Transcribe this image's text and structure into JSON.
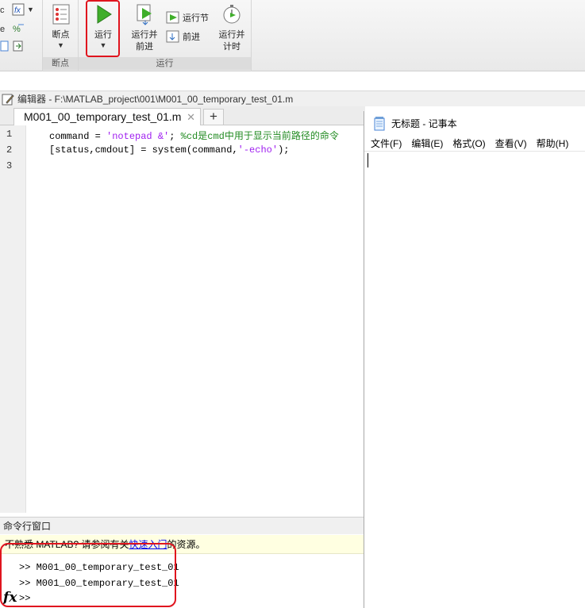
{
  "toolstrip": {
    "breakpoints_label": "断点",
    "breakpoints_section": "断点",
    "run_label": "运行",
    "run_advance_line1": "运行并",
    "run_advance_line2": "前进",
    "run_section_label": "运行节",
    "advance_label": "前进",
    "run_time_line1": "运行并",
    "run_time_line2": "计时",
    "run_section": "运行"
  },
  "editor": {
    "title": "编辑器 - F:\\MATLAB_project\\001\\M001_00_temporary_test_01.m",
    "tab_label": "M001_00_temporary_test_01.m",
    "tab_close": "✕",
    "add_tab": "+",
    "line_numbers": [
      "1",
      "2",
      "3"
    ],
    "line1_var": "command = ",
    "line1_str": "'notepad &'",
    "line1_semi": "; ",
    "line1_comment": "%cd是cmd中用于显示当前路径的命令",
    "line2_pre": "[status,cmdout] = system(command,",
    "line2_str": "'-echo'",
    "line2_post": ");"
  },
  "command_window": {
    "title": "命令行窗口",
    "banner_pre": "不熟悉 MATLAB? 请参阅有关",
    "banner_link": "快速入门",
    "banner_post": "的资源。",
    "lines": [
      ">> M001_00_temporary_test_01",
      ">> M001_00_temporary_test_01",
      ">>"
    ],
    "fx": "fx"
  },
  "notepad": {
    "title": "无标题 - 记事本",
    "menu": [
      "文件(F)",
      "编辑(E)",
      "格式(O)",
      "查看(V)",
      "帮助(H)"
    ]
  },
  "colors": {
    "highlight_red": "#e0141e",
    "string_purple": "#a020f0",
    "comment_green": "#228b22",
    "run_green": "#3fae2a"
  }
}
